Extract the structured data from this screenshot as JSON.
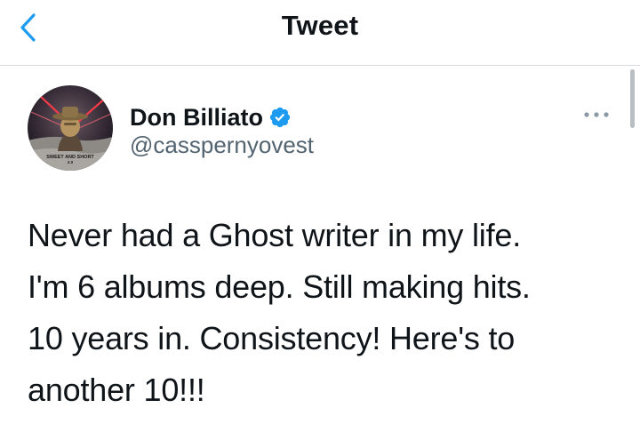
{
  "header": {
    "title": "Tweet",
    "back_icon": "chevron-left-icon"
  },
  "tweet": {
    "author": {
      "display_name": "Don Billiato",
      "handle": "@casspernyovest",
      "verified": true,
      "verified_icon": "verified-badge-icon",
      "avatar_caption": "SWEET AND SHORT",
      "avatar_caption_sub": "2.0"
    },
    "more_icon": "more-horizontal-icon",
    "text_lines": [
      "Never had a Ghost writer in my life.",
      "I'm 6 albums deep. Still making hits.",
      "10 years in. Consistency! Here's to",
      "another 10!!!"
    ]
  },
  "colors": {
    "accent": "#1d9bf0",
    "text_primary": "#0f1419",
    "text_secondary": "#536471",
    "divider": "#d6dadd"
  }
}
